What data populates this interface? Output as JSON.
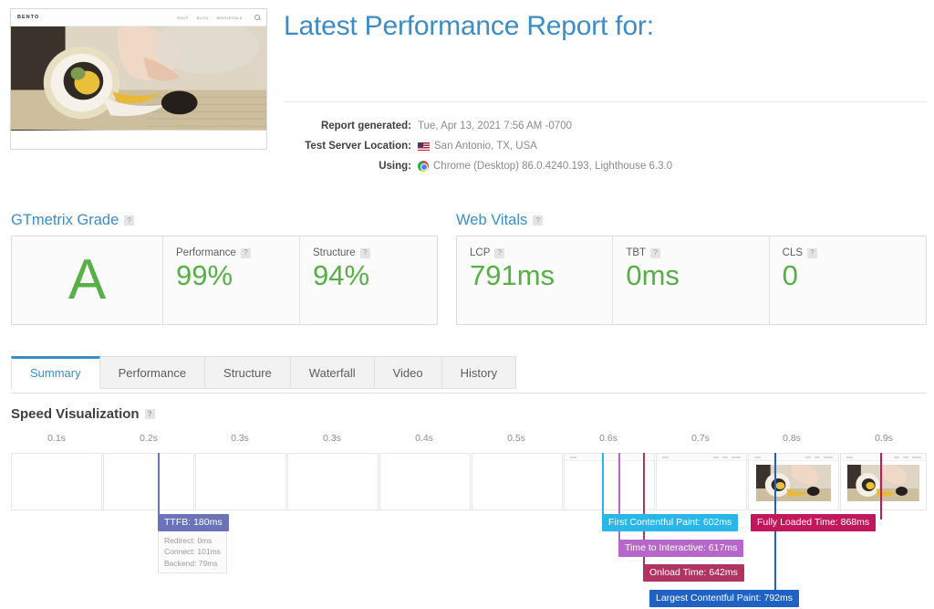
{
  "header": {
    "title": "Latest Performance Report for:",
    "site_logo": "BENTO",
    "site_nav": [
      "SHOP",
      "BLOG",
      "WHOLESALE"
    ],
    "search_icon": "search-icon",
    "meta": [
      {
        "label": "Report generated:",
        "value": "Tue, Apr 13, 2021 7:56 AM -0700",
        "icon": ""
      },
      {
        "label": "Test Server Location:",
        "value": "San Antonio, TX, USA",
        "icon": "us-flag-icon"
      },
      {
        "label": "Using:",
        "value": "Chrome (Desktop) 86.0.4240.193, Lighthouse 6.3.0",
        "icon": "chrome-icon"
      }
    ]
  },
  "grade_section": {
    "title": "GTmetrix Grade",
    "help": "?",
    "grade": "A",
    "metrics": [
      {
        "label": "Performance",
        "help": "?",
        "value": "99%"
      },
      {
        "label": "Structure",
        "help": "?",
        "value": "94%"
      }
    ]
  },
  "vitals_section": {
    "title": "Web Vitals",
    "help": "?",
    "metrics": [
      {
        "label": "LCP",
        "help": "?",
        "value": "791ms"
      },
      {
        "label": "TBT",
        "help": "?",
        "value": "0ms"
      },
      {
        "label": "CLS",
        "help": "?",
        "value": "0"
      }
    ]
  },
  "tabs": [
    {
      "label": "Summary",
      "active": true
    },
    {
      "label": "Performance",
      "active": false
    },
    {
      "label": "Structure",
      "active": false
    },
    {
      "label": "Waterfall",
      "active": false
    },
    {
      "label": "Video",
      "active": false
    },
    {
      "label": "History",
      "active": false
    }
  ],
  "speed_visualization": {
    "title": "Speed Visualization",
    "help": "?"
  },
  "colors": {
    "accent_blue": "#3c8dc5",
    "green": "#56b045",
    "ttfb": "#6a72b8",
    "fcp": "#29b6e8",
    "tti": "#b667c9",
    "onload": "#b0345f",
    "lcp": "#1f62c4",
    "fully_loaded": "#c2185b"
  },
  "chart_data": {
    "type": "timeline",
    "title": "Speed Visualization",
    "xlabel": "",
    "unit": "s",
    "xlim": [
      0,
      0.95
    ],
    "tick_labels": [
      "0.1s",
      "0.2s",
      "0.3s",
      "0.3s",
      "0.4s",
      "0.5s",
      "0.6s",
      "0.7s",
      "0.8s",
      "0.9s"
    ],
    "tick_positions_s": [
      0.1,
      0.2,
      0.3,
      0.3,
      0.4,
      0.5,
      0.6,
      0.7,
      0.8,
      0.9
    ],
    "frames": [
      {
        "index": 1,
        "rendered": false
      },
      {
        "index": 2,
        "rendered": false
      },
      {
        "index": 3,
        "rendered": false
      },
      {
        "index": 4,
        "rendered": false
      },
      {
        "index": 5,
        "rendered": false
      },
      {
        "index": 6,
        "rendered": false
      },
      {
        "index": 7,
        "rendered": false
      },
      {
        "index": 8,
        "rendered": false
      },
      {
        "index": 9,
        "rendered": true
      },
      {
        "index": 10,
        "rendered": true
      }
    ],
    "markers": [
      {
        "name": "TTFB",
        "label": "TTFB: 180ms",
        "value_ms": 180,
        "color": "#6a72b8",
        "details": [
          "Redirect: 0ms",
          "Connect: 101ms",
          "Backend: 79ms"
        ]
      },
      {
        "name": "First Contentful Paint",
        "label": "First Contentful Paint: 602ms",
        "value_ms": 602,
        "color": "#29b6e8",
        "details": []
      },
      {
        "name": "Time to Interactive",
        "label": "Time to Interactive: 617ms",
        "value_ms": 617,
        "color": "#b667c9",
        "details": []
      },
      {
        "name": "Onload Time",
        "label": "Onload Time: 642ms",
        "value_ms": 642,
        "color": "#b0345f",
        "details": []
      },
      {
        "name": "Largest Contentful Paint",
        "label": "Largest Contentful Paint: 792ms",
        "value_ms": 792,
        "color": "#1f62c4",
        "details": []
      },
      {
        "name": "Fully Loaded Time",
        "label": "Fully Loaded Time: 868ms",
        "value_ms": 868,
        "color": "#c2185b",
        "details": []
      }
    ]
  }
}
